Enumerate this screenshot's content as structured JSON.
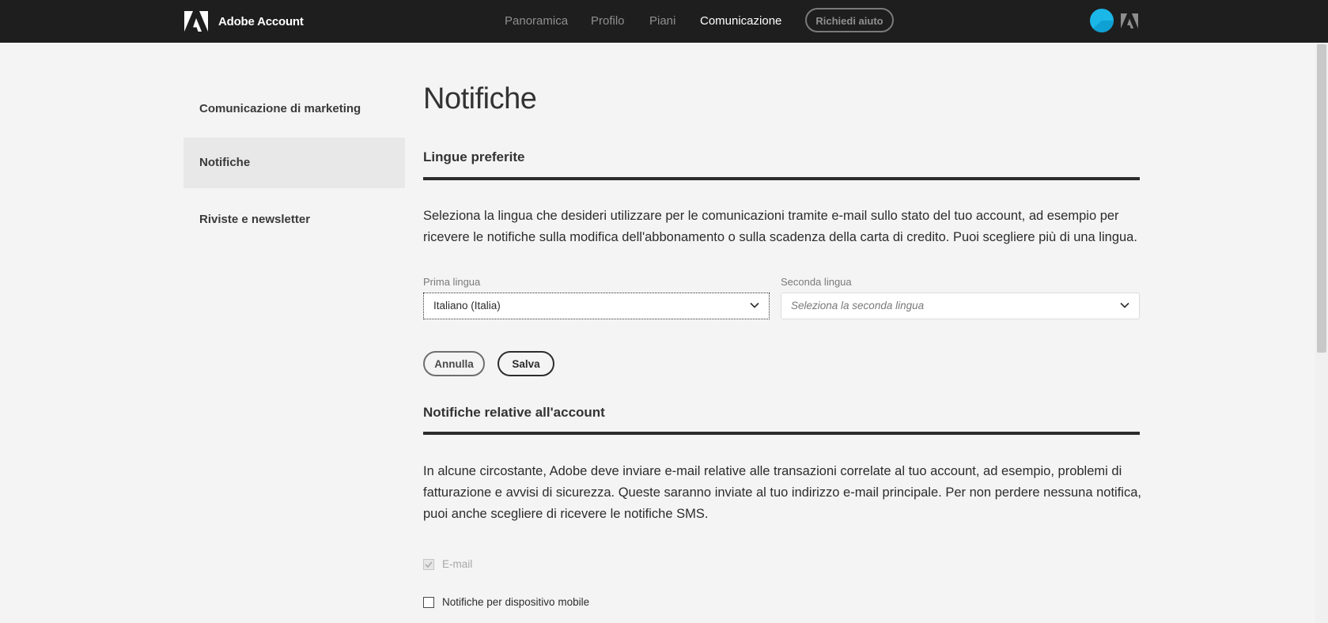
{
  "header": {
    "brand": "Adobe Account",
    "nav": [
      {
        "label": "Panoramica",
        "active": false
      },
      {
        "label": "Profilo",
        "active": false
      },
      {
        "label": "Piani",
        "active": false
      },
      {
        "label": "Comunicazione",
        "active": true
      }
    ],
    "help_label": "Richiedi aiuto"
  },
  "sidebar": {
    "items": [
      {
        "label": "Comunicazione di marketing",
        "active": false
      },
      {
        "label": "Notifiche",
        "active": true
      },
      {
        "label": "Riviste e newsletter",
        "active": false
      }
    ]
  },
  "main": {
    "title": "Notifiche",
    "languages": {
      "title": "Lingue preferite",
      "description": "Seleziona la lingua che desideri utilizzare per le comunicazioni tramite e-mail sullo stato del tuo account, ad esempio per ricevere le notifiche sulla modifica dell'abbonamento o sulla scadenza della carta di credito. Puoi scegliere più di una lingua.",
      "first_label": "Prima lingua",
      "first_value": "Italiano (Italia)",
      "second_label": "Seconda lingua",
      "second_placeholder": "Seleziona la seconda lingua",
      "cancel_label": "Annulla",
      "save_label": "Salva"
    },
    "account_notifications": {
      "title": "Notifiche relative all'account",
      "description": "In alcune circostante, Adobe deve inviare e-mail relative alle transazioni correlate al tuo account, ad esempio, problemi di fatturazione e avvisi di sicurezza. Queste saranno inviate al tuo indirizzo e-mail principale. Per non perdere nessuna notifica, puoi anche scegliere di ricevere le notifiche SMS.",
      "email_label": "E-mail",
      "email_checked": true,
      "email_disabled": true,
      "mobile_label": "Notifiche per dispositivo mobile",
      "mobile_checked": false
    }
  },
  "colors": {
    "topbar": "#1e1e1e",
    "background": "#f4f4f4",
    "avatar": "#1bb7e8"
  }
}
